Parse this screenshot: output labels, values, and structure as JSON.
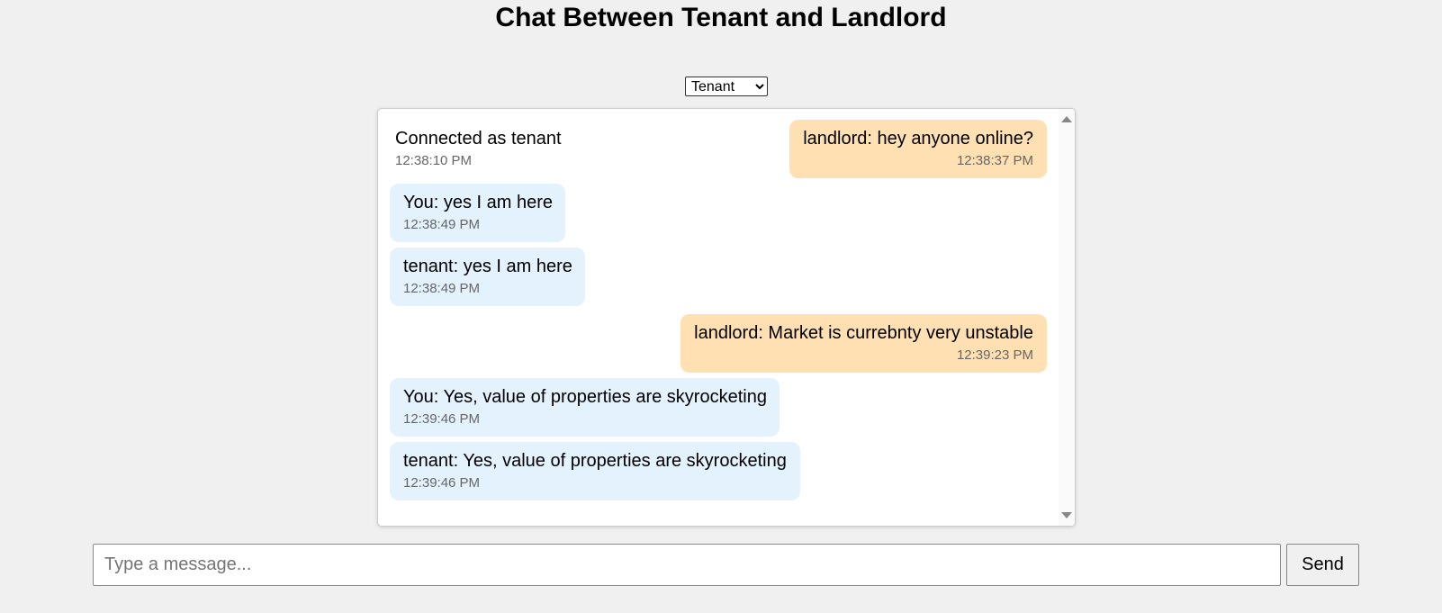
{
  "page": {
    "title": "Chat Between Tenant and Landlord"
  },
  "role_select": {
    "selected": "Tenant",
    "options": [
      "Tenant",
      "Landlord"
    ]
  },
  "messages": [
    {
      "kind": "system",
      "text": "Connected as tenant",
      "time": "12:38:10 PM"
    },
    {
      "kind": "other",
      "text": "landlord: hey anyone online?",
      "time": "12:38:37 PM"
    },
    {
      "kind": "mine",
      "text": "You: yes I am here",
      "time": "12:38:49 PM"
    },
    {
      "kind": "mine",
      "text": "tenant: yes I am here",
      "time": "12:38:49 PM"
    },
    {
      "kind": "other",
      "text": "landlord: Market is currebnty very unstable",
      "time": "12:39:23 PM"
    },
    {
      "kind": "mine",
      "text": "You: Yes, value of properties are skyrocketing",
      "time": "12:39:46 PM"
    },
    {
      "kind": "mine",
      "text": "tenant: Yes, value of properties are skyrocketing",
      "time": "12:39:46 PM"
    }
  ],
  "composer": {
    "placeholder": "Type a message...",
    "value": "",
    "send_label": "Send"
  },
  "colors": {
    "background": "#f0f0f0",
    "mine_bubble": "#e3f2fd",
    "other_bubble": "#ffe0b2",
    "timestamp": "#666666"
  }
}
